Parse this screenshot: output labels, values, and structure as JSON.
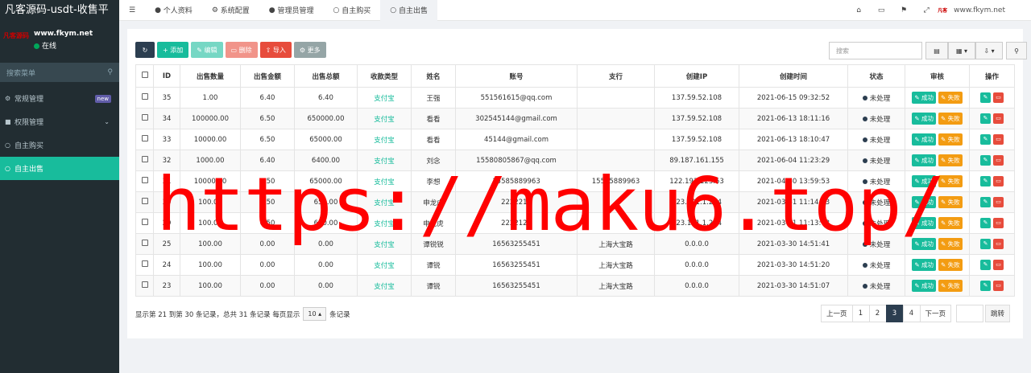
{
  "sidebar": {
    "brand": "凡客源码-usdt-收售平",
    "logo_text": "凡客源码",
    "site": "www.fkym.net",
    "status": "在线",
    "search_placeholder": "搜索菜单",
    "items": [
      {
        "label": "常规管理",
        "badge": "new"
      },
      {
        "label": "权限管理"
      },
      {
        "label": "自主购买"
      },
      {
        "label": "自主出售"
      }
    ]
  },
  "topbar": {
    "tabs": [
      "个人资料",
      "系统配置",
      "管理员管理",
      "自主购买",
      "自主出售"
    ],
    "site": "www.fkym.net"
  },
  "toolbar": {
    "add": "添加",
    "edit": "编辑",
    "delete": "删除",
    "import": "导入",
    "more": "更多"
  },
  "search_placeholder": "搜索",
  "table": {
    "headers": [
      "ID",
      "出售数量",
      "出售金额",
      "出售总额",
      "收款类型",
      "姓名",
      "账号",
      "支行",
      "创建IP",
      "创建时间",
      "状态",
      "审核",
      "操作"
    ],
    "rows": [
      [
        "35",
        "1.00",
        "6.40",
        "6.40",
        "支付宝",
        "王强",
        "551561615@qq.com",
        "",
        "137.59.52.108",
        "2021-06-15 09:32:52",
        "未处理"
      ],
      [
        "34",
        "100000.00",
        "6.50",
        "650000.00",
        "支付宝",
        "看看",
        "302545144@gmail.com",
        "",
        "137.59.52.108",
        "2021-06-13 18:11:16",
        "未处理"
      ],
      [
        "33",
        "10000.00",
        "6.50",
        "65000.00",
        "支付宝",
        "看看",
        "45144@gmail.com",
        "",
        "137.59.52.108",
        "2021-06-13 18:10:47",
        "未处理"
      ],
      [
        "32",
        "1000.00",
        "6.40",
        "6400.00",
        "支付宝",
        "刘念",
        "15580805867@qq.com",
        "",
        "89.187.161.155",
        "2021-06-04 11:23:29",
        "未处理"
      ],
      [
        "31",
        "10000.00",
        "6.50",
        "65000.00",
        "支付宝",
        "李想",
        "15585889963",
        "15585889963",
        "122.192.123.53",
        "2021-04-30 13:59:53",
        "未处理"
      ],
      [
        "30",
        "100.00",
        "6.50",
        "650.00",
        "支付宝",
        "申龙虎",
        "2222212",
        "",
        "223.121.1.204",
        "2021-03-31 11:14:43",
        "未处理"
      ],
      [
        "29",
        "100.00",
        "6.50",
        "650.00",
        "支付宝",
        "申龙虎",
        "2222121",
        "",
        "123.121.1.204",
        "2021-03-31 11:13:03",
        "未处理"
      ],
      [
        "25",
        "100.00",
        "0.00",
        "0.00",
        "支付宝",
        "谭锐锐",
        "16563255451",
        "上海大宝路",
        "0.0.0.0",
        "2021-03-30 14:51:41",
        "未处理"
      ],
      [
        "24",
        "100.00",
        "0.00",
        "0.00",
        "支付宝",
        "谭锐",
        "16563255451",
        "上海大宝路",
        "0.0.0.0",
        "2021-03-30 14:51:20",
        "未处理"
      ],
      [
        "23",
        "100.00",
        "0.00",
        "0.00",
        "支付宝",
        "谭锐",
        "16563255451",
        "上海大宝路",
        "0.0.0.0",
        "2021-03-30 14:51:07",
        "未处理"
      ]
    ],
    "success_label": "成功",
    "fail_label": "失败"
  },
  "footer": {
    "summary": "显示第 21 到第 30 条记录，总共 31 条记录 每页显示",
    "page_size": "10",
    "suffix": "条记录"
  },
  "pager": {
    "prev": "上一页",
    "pages": [
      "1",
      "2",
      "3",
      "4"
    ],
    "current": "3",
    "next": "下一页",
    "go": "跳转"
  },
  "watermark": "https://maku6.top/"
}
